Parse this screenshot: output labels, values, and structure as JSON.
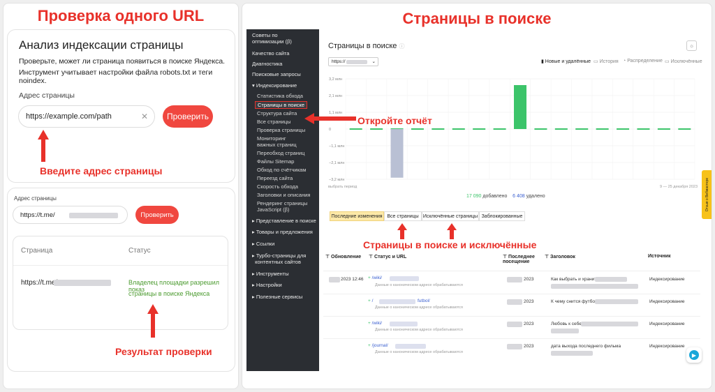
{
  "left": {
    "title": "Проверка одного URL",
    "card1": {
      "heading": "Анализ индексации страницы",
      "desc_line1": "Проверьте, может ли страница появиться в поиске Яндекса.",
      "desc_line2": "Инструмент учитывает настройки файла robots.txt и теги noindex.",
      "field_label": "Адрес страницы",
      "input_value": "https://example.com/path",
      "button": "Проверить",
      "annotation": "Введите адрес страницы"
    },
    "card2": {
      "field_label": "Адрес страницы",
      "input_value": "https://t.me/",
      "button": "Проверить",
      "col_page": "Страница",
      "col_status": "Статус",
      "row_page": "https://t.me/",
      "row_status_line1": "Владелец площадки разрешил показ",
      "row_status_line2": "страницы в поиске Яндекса",
      "annotation": "Результат проверки"
    }
  },
  "right": {
    "title": "Страницы в поиске",
    "annotation_open": "Откройте отчёт",
    "annotation_tabs": "Страницы в поиске и исключённые"
  },
  "sidebar": {
    "items": [
      {
        "label": "Советы по",
        "label2": "оптимизации (β)"
      },
      {
        "label": "Качество сайта"
      },
      {
        "label": "Диагностика"
      },
      {
        "label": "Поисковые запросы"
      },
      {
        "label": "Индексирование"
      }
    ],
    "sub": [
      "Статистика обхода",
      "Страницы в поиске",
      "Структура сайта",
      "Все страницы",
      "Проверка страницы",
      "Мониторинг",
      "важных страниц",
      "Переобход страниц",
      "Файлы Sitemap",
      "Обход по счётчикам",
      "Переезд сайта",
      "Скорость обхода",
      "Заголовки и описания",
      "Рендеринг страницы",
      "JavaScript (β)"
    ],
    "bottom": [
      "Представление в поиске",
      "Товары и предложения",
      "Ссылки",
      "Турбо-страницы для",
      "контентных сайтов",
      "Инструменты",
      "Настройки",
      "Полезные сервисы"
    ]
  },
  "report": {
    "title": "Страницы в поиске",
    "site_select": "https://",
    "toggles": [
      "Новые и удалённые",
      "История",
      "Распределение",
      "Исключённые"
    ],
    "period_left": "выбрать период",
    "period_right": "9 — 25 декабря 2023",
    "added_value": "17 090",
    "added_label": "добавлено",
    "removed_value": "6 408",
    "removed_label": "удалено",
    "tabs": [
      "Последние изменения",
      "Все страницы",
      "Исключённые страницы",
      "Заблокированные"
    ],
    "columns": [
      "Обновление",
      "Статус и URL",
      "Последнее посещение",
      "Заголовок",
      "Источник"
    ],
    "rows": [
      {
        "date": "2023 12:46",
        "url": "/wiki/",
        "sub": "Данные о каноническом адресе обрабатываются",
        "visit": "2023",
        "title": "Как выбрать и хранить",
        "source": "Индексирование"
      },
      {
        "date": "",
        "url": "/",
        "url2": "futbol/",
        "sub": "Данные о каноническом адресе обрабатываются",
        "visit": "2023",
        "title": "К чему снится футбол",
        "source": "Индексирование"
      },
      {
        "date": "",
        "url": "/wiki/",
        "sub": "Данные о каноническом адресе обрабатываются",
        "visit": "2023",
        "title": "Любовь к себе",
        "source": "Индексирование"
      },
      {
        "date": "",
        "url": "/journal/",
        "sub": "Данные о каноническом адресе обрабатываются",
        "visit": "2023",
        "title": "дата выхода последнего фильма",
        "source": "Индексирование"
      }
    ],
    "feedback_tab": "Отзыв о Вебмастере"
  },
  "chart_data": {
    "type": "bar",
    "yticks": [
      "3,2 млн",
      "2,1 млн",
      "1,1 млн",
      "0",
      "−1,1 млн",
      "−2,1 млн",
      "−3,2 млн"
    ],
    "ylim": [
      -3200000,
      3200000
    ],
    "categories": [
      "d1",
      "d2",
      "d3",
      "d4",
      "d5",
      "d6",
      "d7",
      "d8",
      "d9",
      "d10",
      "d11",
      "d12",
      "d13",
      "d14",
      "d15",
      "d16",
      "d17"
    ],
    "series": [
      {
        "values": [
          0,
          0,
          0,
          0,
          0,
          0,
          0,
          0,
          2800000,
          0,
          0,
          0,
          0,
          0,
          0,
          0,
          0
        ],
        "color": "#3cc46a"
      },
      {
        "values": [
          0,
          0,
          -3100000,
          0,
          0,
          0,
          0,
          0,
          0,
          0,
          0,
          0,
          0,
          0,
          0,
          0,
          0
        ],
        "color": "#b9c0d4"
      }
    ]
  },
  "colors": {
    "accent": "#e8312a",
    "button": "#f0473f",
    "green": "#3cc46a",
    "sidebar": "#2b2e33"
  }
}
